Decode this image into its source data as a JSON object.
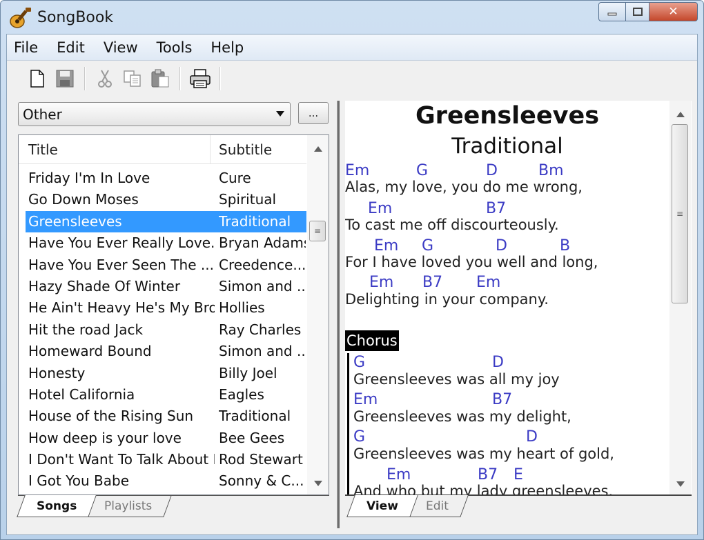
{
  "window": {
    "title": "SongBook",
    "controls": {
      "minimize": "▁",
      "maximize": "▢",
      "close": "✕"
    }
  },
  "menu": [
    "File",
    "Edit",
    "View",
    "Tools",
    "Help"
  ],
  "toolbar": {
    "icons": [
      "new-icon",
      "save-icon",
      "cut-icon",
      "copy-icon",
      "paste-icon",
      "print-icon"
    ]
  },
  "category": {
    "selected": "Other",
    "more_label": "..."
  },
  "song_list": {
    "columns": {
      "title": "Title",
      "subtitle": "Subtitle"
    },
    "rows": [
      {
        "title": "Friday I'm In Love",
        "subtitle": "Cure"
      },
      {
        "title": "Go Down Moses",
        "subtitle": "Spiritual"
      },
      {
        "title": "Greensleeves",
        "subtitle": "Traditional"
      },
      {
        "title": "Have You Ever Really Love...",
        "subtitle": "Bryan Adams"
      },
      {
        "title": "Have You Ever Seen The ...",
        "subtitle": "Creedence..."
      },
      {
        "title": "Hazy Shade Of Winter",
        "subtitle": "Simon and ..."
      },
      {
        "title": "He Ain't Heavy He's My Bro...",
        "subtitle": "Hollies"
      },
      {
        "title": "Hit the road Jack",
        "subtitle": "Ray Charles"
      },
      {
        "title": "Homeward Bound",
        "subtitle": "Simon and ..."
      },
      {
        "title": "Honesty",
        "subtitle": "Billy Joel"
      },
      {
        "title": "Hotel California",
        "subtitle": "Eagles"
      },
      {
        "title": "House of the Rising Sun",
        "subtitle": "Traditional"
      },
      {
        "title": "How deep is your love",
        "subtitle": "Bee Gees"
      },
      {
        "title": "I Don't Want To Talk About It",
        "subtitle": "Rod Stewart"
      },
      {
        "title": "I Got You Babe",
        "subtitle": "Sonny & C..."
      }
    ],
    "selected_title": "Greensleeves"
  },
  "left_tabs": {
    "songs": "Songs",
    "playlists": "Playlists",
    "active": "Songs"
  },
  "right_tabs": {
    "view": "View",
    "edit": "Edit",
    "active": "View"
  },
  "song": {
    "title": "Greensleeves",
    "subtitle": "Traditional",
    "verse": [
      {
        "chords": [
          "Em",
          "G",
          "D",
          "Bm"
        ],
        "lyric": "Alas, my love, you do me wrong,"
      },
      {
        "chords": [
          "Em",
          "B7"
        ],
        "lyric": "To cast me off discourteously."
      },
      {
        "chords": [
          "Em",
          "G",
          "D",
          "B"
        ],
        "lyric": "For I have loved you well and long,"
      },
      {
        "chords": [
          "Em",
          "B7",
          "Em"
        ],
        "lyric": "Delighting in your company."
      }
    ],
    "chorus_label": "Chorus",
    "chorus": [
      {
        "chords": [
          "G",
          "D"
        ],
        "lyric": "Greensleeves was all my joy"
      },
      {
        "chords": [
          "Em",
          "B7"
        ],
        "lyric": "Greensleeves was my delight,"
      },
      {
        "chords": [
          "G",
          "D"
        ],
        "lyric": "Greensleeves was my heart of gold,"
      },
      {
        "chords": [
          "Em",
          "B7",
          "E"
        ],
        "lyric": "And who but my lady greensleeves."
      }
    ]
  }
}
